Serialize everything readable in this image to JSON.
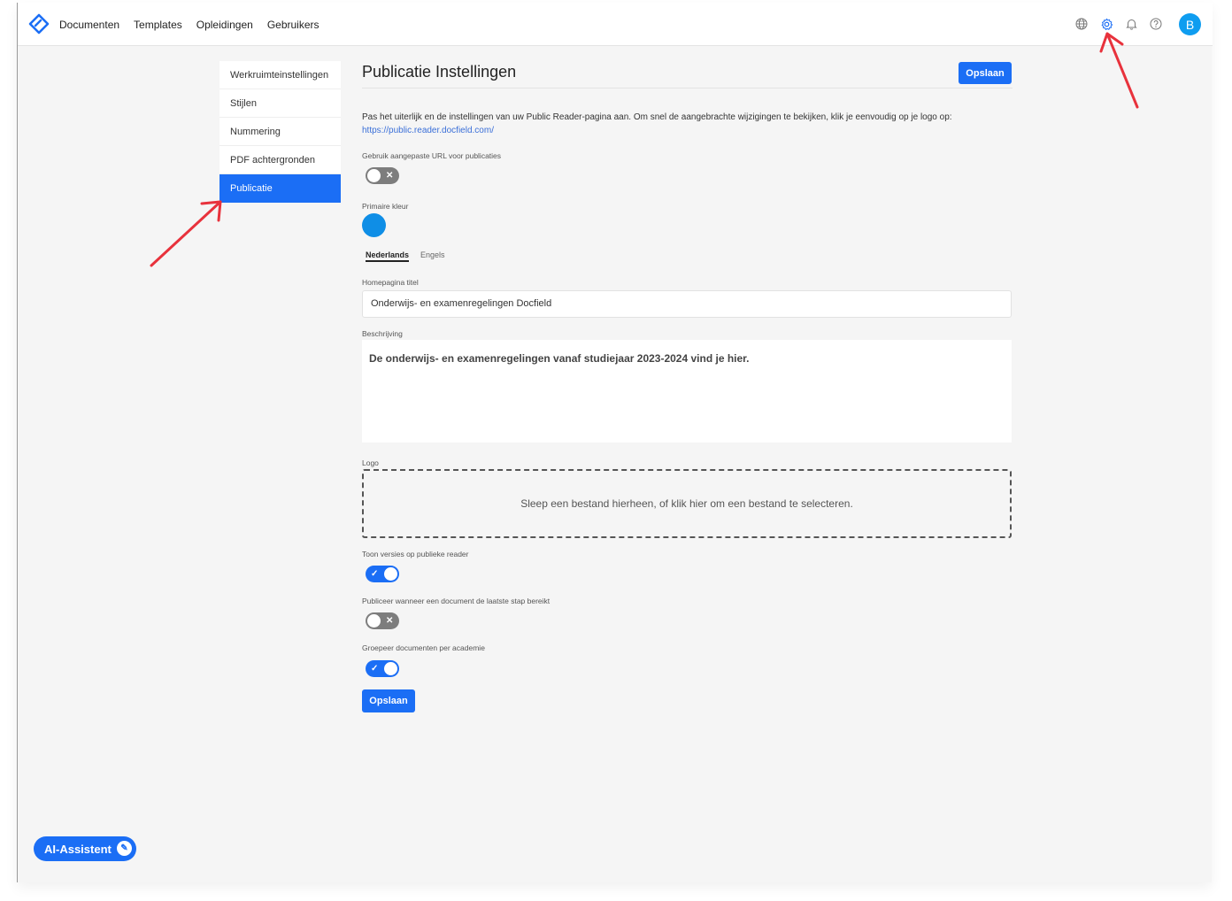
{
  "nav": {
    "items": [
      "Documenten",
      "Templates",
      "Opleidingen",
      "Gebruikers"
    ]
  },
  "topbar": {
    "icons": [
      "globe-icon",
      "gear-icon",
      "bell-icon",
      "help-icon"
    ],
    "avatar_initial": "B",
    "accent": "#1b6ef5"
  },
  "sidebar": {
    "items": [
      {
        "label": "Werkruimteinstellingen",
        "active": false
      },
      {
        "label": "Stijlen",
        "active": false
      },
      {
        "label": "Nummering",
        "active": false
      },
      {
        "label": "PDF achtergronden",
        "active": false
      },
      {
        "label": "Publicatie",
        "active": true
      }
    ]
  },
  "page": {
    "title": "Publicatie Instellingen",
    "save_top": "Opslaan",
    "description": "Pas het uiterlijk en de instellingen van uw Public Reader-pagina aan. Om snel de aangebrachte wijzigingen te bekijken, klik je eenvoudig op je logo op:",
    "link": "https://public.reader.docfield.com/",
    "custom_url_label": "Gebruik aangepaste URL voor publicaties",
    "custom_url_enabled": false,
    "primary_color_label": "Primaire kleur",
    "primary_color": "#0f8ee6",
    "tabs": [
      {
        "label": "Nederlands",
        "active": true
      },
      {
        "label": "Engels",
        "active": false
      }
    ],
    "homepage_title_label": "Homepagina titel",
    "homepage_title_value": "Onderwijs- en examenregelingen Docfield",
    "description_label": "Beschrijving",
    "description_value": "De onderwijs- en examenregelingen vanaf studiejaar 2023-2024 vind je hier.",
    "logo_label": "Logo",
    "logo_drop_text": "Sleep een bestand hierheen, of klik hier om een bestand te selecteren.",
    "toggles": [
      {
        "label": "Toon versies op publieke reader",
        "enabled": true
      },
      {
        "label": "Publiceer wanneer een document de laatste stap bereikt",
        "enabled": false
      },
      {
        "label": "Groepeer documenten per academie",
        "enabled": true
      }
    ],
    "save_bottom": "Opslaan"
  },
  "assistant": {
    "label": "AI-Assistent"
  },
  "annotation_color": "#e8323c"
}
